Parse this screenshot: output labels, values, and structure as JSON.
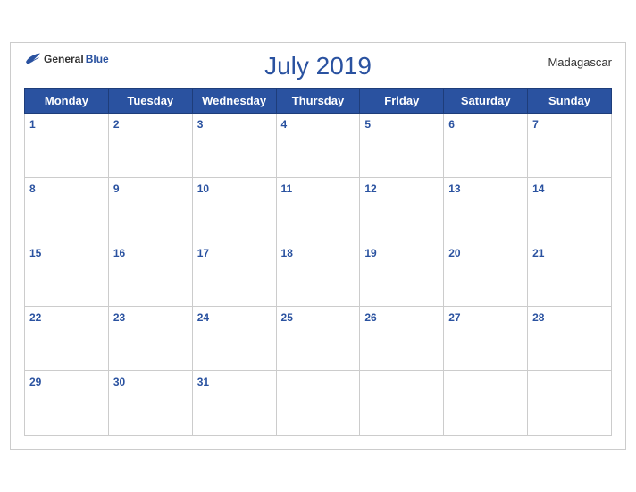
{
  "calendar": {
    "title": "July 2019",
    "country": "Madagascar",
    "logo": {
      "general": "General",
      "blue": "Blue"
    },
    "days_of_week": [
      "Monday",
      "Tuesday",
      "Wednesday",
      "Thursday",
      "Friday",
      "Saturday",
      "Sunday"
    ],
    "weeks": [
      [
        {
          "day": 1,
          "empty": false
        },
        {
          "day": 2,
          "empty": false
        },
        {
          "day": 3,
          "empty": false
        },
        {
          "day": 4,
          "empty": false
        },
        {
          "day": 5,
          "empty": false
        },
        {
          "day": 6,
          "empty": false
        },
        {
          "day": 7,
          "empty": false
        }
      ],
      [
        {
          "day": 8,
          "empty": false
        },
        {
          "day": 9,
          "empty": false
        },
        {
          "day": 10,
          "empty": false
        },
        {
          "day": 11,
          "empty": false
        },
        {
          "day": 12,
          "empty": false
        },
        {
          "day": 13,
          "empty": false
        },
        {
          "day": 14,
          "empty": false
        }
      ],
      [
        {
          "day": 15,
          "empty": false
        },
        {
          "day": 16,
          "empty": false
        },
        {
          "day": 17,
          "empty": false
        },
        {
          "day": 18,
          "empty": false
        },
        {
          "day": 19,
          "empty": false
        },
        {
          "day": 20,
          "empty": false
        },
        {
          "day": 21,
          "empty": false
        }
      ],
      [
        {
          "day": 22,
          "empty": false
        },
        {
          "day": 23,
          "empty": false
        },
        {
          "day": 24,
          "empty": false
        },
        {
          "day": 25,
          "empty": false
        },
        {
          "day": 26,
          "empty": false
        },
        {
          "day": 27,
          "empty": false
        },
        {
          "day": 28,
          "empty": false
        }
      ],
      [
        {
          "day": 29,
          "empty": false
        },
        {
          "day": 30,
          "empty": false
        },
        {
          "day": 31,
          "empty": false
        },
        {
          "day": null,
          "empty": true
        },
        {
          "day": null,
          "empty": true
        },
        {
          "day": null,
          "empty": true
        },
        {
          "day": null,
          "empty": true
        }
      ]
    ]
  }
}
